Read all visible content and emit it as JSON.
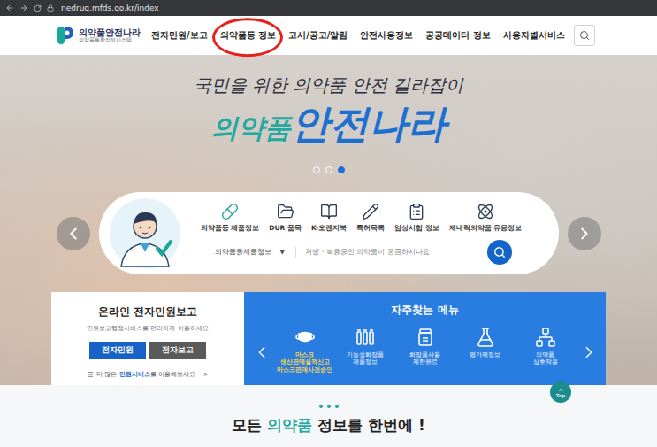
{
  "browser": {
    "address": "nedrug.mfds.go.kr/index"
  },
  "header": {
    "logo_title": "의약품안전나라",
    "logo_subtitle": "의약품통합정보시스템",
    "nav": [
      {
        "label": "전자민원/보고",
        "highlighted": false
      },
      {
        "label": "의약품등 정보",
        "highlighted": true
      },
      {
        "label": "고시/공고/알림",
        "highlighted": false
      },
      {
        "label": "안전사용정보",
        "highlighted": false
      },
      {
        "label": "공공데이터 정보",
        "highlighted": false
      },
      {
        "label": "사용자별서비스",
        "highlighted": false
      }
    ]
  },
  "hero": {
    "tagline": "국민을 위한 의약품 안전 길라잡이",
    "title_small": "의약품",
    "title_large": "안전나라",
    "slides": [
      {
        "selected": false
      },
      {
        "selected": false
      },
      {
        "selected": true
      }
    ]
  },
  "quick_search": {
    "items": [
      "의약품등 제품정보",
      "DUR 품목",
      "K-오렌지북",
      "특허목록",
      "임상시험 정보",
      "제네릭의약품 유용정보"
    ],
    "category": "의약품등제품정보",
    "dropdown_glyph": "▼",
    "placeholder": "처방・복용중인 의약품이 궁금하시나요"
  },
  "civil_card": {
    "title": "온라인 전자민원보고",
    "subtitle": "민원보고행정서비스를 편리하게 이용하세요",
    "buttons": [
      {
        "label": "전자민원",
        "selected": true
      },
      {
        "label": "전자보고",
        "selected": false
      }
    ],
    "more_prefix": "더 많은 ",
    "more_link": "민원서비스",
    "more_suffix": "를 이용해보세요",
    "more_glyph": ">"
  },
  "frequent_menu": {
    "title": "자주찾는 메뉴",
    "items": [
      {
        "lines": [
          "마스크",
          "생산판매실적신고",
          "마스크판매사전승인"
        ],
        "highlighted": true
      },
      {
        "lines": [
          "기능성화장품",
          "제품정보"
        ],
        "highlighted": false
      },
      {
        "lines": [
          "화장품사용",
          "제한원료"
        ],
        "highlighted": false
      },
      {
        "lines": [
          "평가제정보"
        ],
        "highlighted": false
      },
      {
        "lines": [
          "의약품",
          "상호작용"
        ],
        "highlighted": false
      }
    ]
  },
  "top_button": {
    "label": "Top"
  },
  "section": {
    "heading_before": "모든 ",
    "heading_accent": "의약품",
    "heading_after": " 정보를 한번에 !"
  }
}
